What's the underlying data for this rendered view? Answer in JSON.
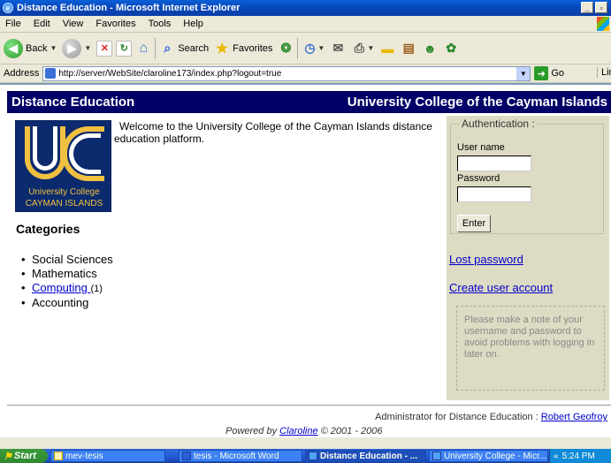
{
  "window": {
    "title": "Distance Education - Microsoft Internet Explorer"
  },
  "menu": {
    "items": [
      "File",
      "Edit",
      "View",
      "Favorites",
      "Tools",
      "Help"
    ]
  },
  "toolbar": {
    "back_label": "Back",
    "search_label": "Search",
    "favorites_label": "Favorites"
  },
  "address": {
    "label": "Address",
    "url": "http://server/WebSite/claroline173/index.php?logout=true",
    "go_label": "Go",
    "links_label": "Links"
  },
  "site": {
    "left_title": "Distance Education",
    "right_title": "University College of the Cayman Islands",
    "welcome": "Welcome to the University College of the Cayman Islands distance education platform.",
    "logo_line1": "University College",
    "logo_line2": "CAYMAN ISLANDS",
    "categories_title": "Categories",
    "categories": [
      {
        "label": "Social Sciences",
        "link": false,
        "count": ""
      },
      {
        "label": "Mathematics",
        "link": false,
        "count": ""
      },
      {
        "label": "Computing ",
        "link": true,
        "count": "(1)"
      },
      {
        "label": "Accounting",
        "link": false,
        "count": ""
      }
    ]
  },
  "auth": {
    "legend": "Authentication :",
    "username_label": "User name",
    "password_label": "Password",
    "enter_label": "Enter",
    "lost_password": "Lost password",
    "create_account": "Create user account",
    "note": "Please make a note of your username and password to avoid problems with logging in later on."
  },
  "footer": {
    "admin_prefix": "Administrator for Distance Education : ",
    "admin_name": "Robert Geofroy",
    "powered_prefix": "Powered by ",
    "powered_link": "Claroline",
    "powered_suffix": " © 2001 - 2006"
  },
  "taskbar": {
    "start_label": "Start",
    "tasks": [
      "mev-tesis",
      "tesis - Microsoft Word",
      "Distance Education - ...",
      "University College - Micr..."
    ],
    "time": "5:24 PM"
  }
}
